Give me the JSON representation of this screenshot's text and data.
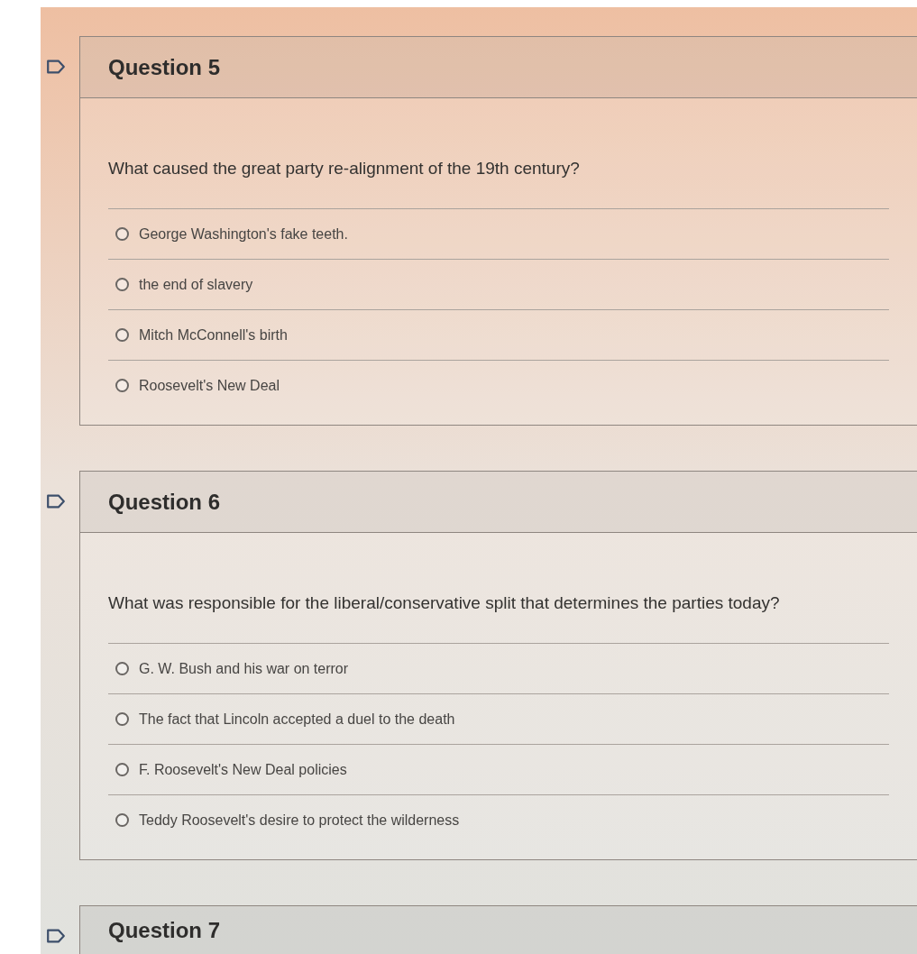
{
  "questions": [
    {
      "title": "Question 5",
      "text": "What caused the great party re-alignment of the 19th century?",
      "options": [
        {
          "label": "George Washington's fake teeth.",
          "selected": false
        },
        {
          "label": "the end of slavery",
          "selected": false
        },
        {
          "label": "Mitch McConnell's birth",
          "selected": false
        },
        {
          "label": "Roosevelt's New Deal",
          "selected": false
        }
      ]
    },
    {
      "title": "Question 6",
      "text": "What was responsible for the liberal/conservative split that determines the parties today?",
      "options": [
        {
          "label": "G. W. Bush and his war on terror",
          "selected": false
        },
        {
          "label": "The fact that Lincoln accepted a duel to the death",
          "selected": false
        },
        {
          "label": "F. Roosevelt's New Deal policies",
          "selected": false
        },
        {
          "label": "Teddy Roosevelt's desire to protect the wilderness",
          "selected": false
        }
      ]
    },
    {
      "title": "Question 7"
    }
  ]
}
